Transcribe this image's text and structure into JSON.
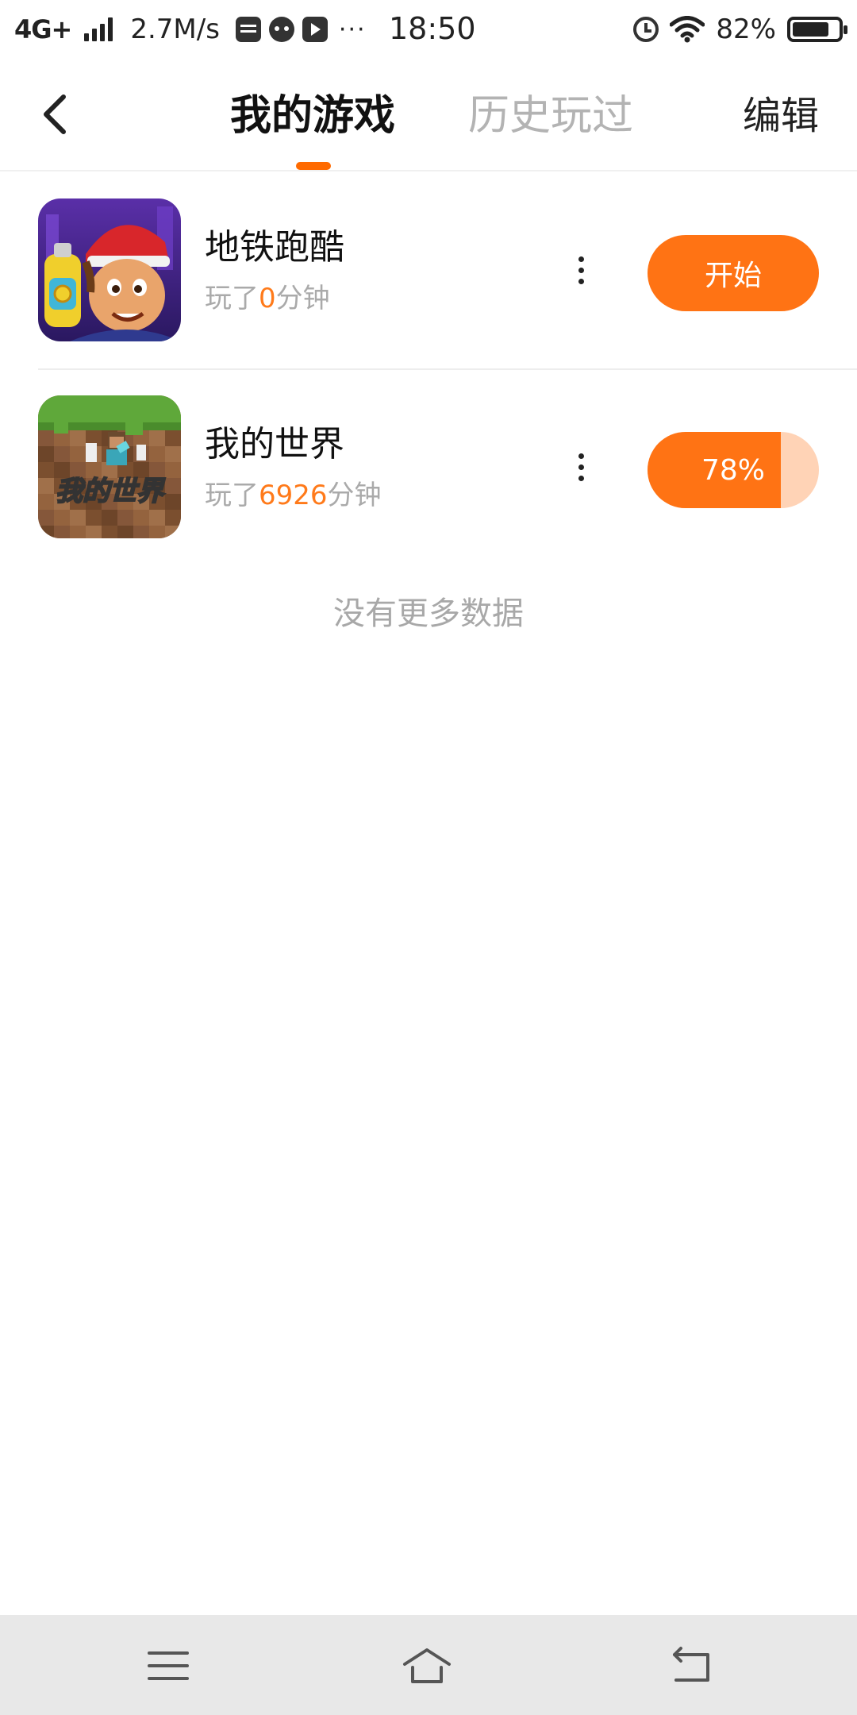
{
  "status_bar": {
    "network": "4G+",
    "speed": "2.7M/s",
    "more": "···",
    "time": "18:50",
    "battery": "82%",
    "battery_level": 0.82
  },
  "header": {
    "tabs": [
      "我的游戏",
      "历史玩过"
    ],
    "active_tab": "我的游戏",
    "edit_label": "编辑"
  },
  "games": [
    {
      "title": "地铁跑酷",
      "played_prefix": "玩了",
      "played_minutes": "0",
      "played_suffix": "分钟",
      "action_label": "开始"
    },
    {
      "title": "我的世界",
      "played_prefix": "玩了",
      "played_minutes": "6926",
      "played_suffix": "分钟",
      "progress_label": "78%",
      "progress": 0.78,
      "icon_text": "我的世界"
    }
  ],
  "no_more_text": "没有更多数据",
  "colors": {
    "accent": "#ff7314",
    "accent_light": "#ffd3b6",
    "tab_indicator": "#ff6a00"
  }
}
